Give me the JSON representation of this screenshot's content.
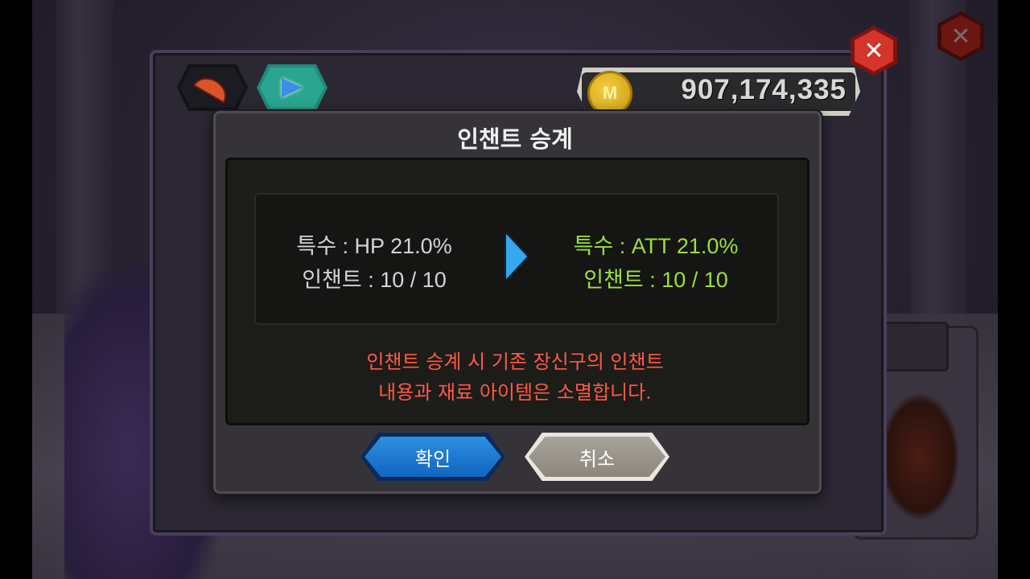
{
  "currency": {
    "coin_label": "M",
    "amount": "907,174,335"
  },
  "dialog": {
    "title": "인챈트 승계",
    "old": {
      "special": "특수 : HP 21.0%",
      "enchant": "인챈트 : 10 / 10"
    },
    "new": {
      "special": "특수 : ATT 21.0%",
      "enchant": "인챈트 : 10 / 10"
    },
    "warning_line1": "인챈트 승계 시 기존 장신구의 인챈트",
    "warning_line2": "내용과 재료 아이템은 소멸합니다.",
    "confirm_label": "확인",
    "cancel_label": "취소"
  },
  "colors": {
    "new_value": "#9be13a",
    "warning": "#ff5a45",
    "confirm": "#1a7ad4"
  },
  "icons": [
    "feather-icon",
    "upgrade-arrow-icon",
    "close-icon",
    "coin-icon",
    "arrow-right-icon"
  ]
}
